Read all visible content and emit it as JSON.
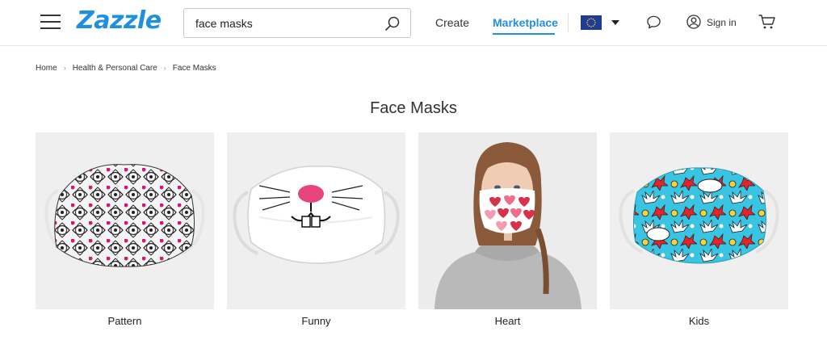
{
  "header": {
    "logo": "Zazzle",
    "search": {
      "value": "face masks",
      "placeholder": ""
    },
    "nav": {
      "create": "Create",
      "marketplace": "Marketplace"
    },
    "signin": "Sign in",
    "icons": {
      "menu": "hamburger-menu-icon",
      "search": "search-icon",
      "flag": "eu-flag-icon",
      "chat": "chat-bubble-icon",
      "user": "user-icon",
      "cart": "cart-icon"
    },
    "accent_color": "#1f8fe0"
  },
  "breadcrumb": [
    "Home",
    "Health & Personal Care",
    "Face Masks"
  ],
  "page_title": "Face Masks",
  "categories": [
    {
      "label": "Pattern"
    },
    {
      "label": "Funny"
    },
    {
      "label": "Heart"
    },
    {
      "label": "Kids"
    }
  ]
}
